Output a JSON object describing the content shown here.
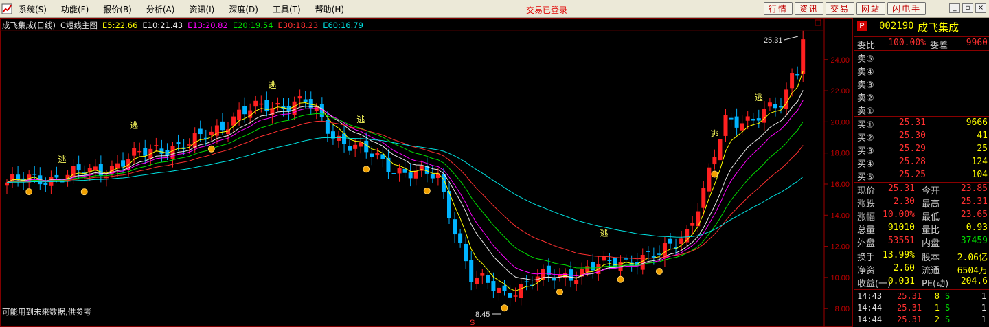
{
  "menubar": {
    "menus": [
      "系统(S)",
      "功能(F)",
      "报价(B)",
      "分析(A)",
      "资讯(I)",
      "深度(D)",
      "工具(T)",
      "帮助(H)"
    ],
    "login_status": "交易已登录",
    "tool_buttons": [
      "行情",
      "资讯",
      "交易",
      "网站",
      "闪电手"
    ],
    "window_buttons": [
      "minimize",
      "restore",
      "close"
    ]
  },
  "chart": {
    "title": "成飞集成(日线)",
    "indicator": "C短线主图",
    "ma": [
      {
        "label": "E5:22.66",
        "color": "#ffff00"
      },
      {
        "label": "E10:21.43",
        "color": "#e8e8e8"
      },
      {
        "label": "E13:20.82",
        "color": "#ff00ff"
      },
      {
        "label": "E20:19.54",
        "color": "#00dd00"
      },
      {
        "label": "E30:18.23",
        "color": "#ff3030"
      },
      {
        "label": "E60:16.79",
        "color": "#00e0e0"
      }
    ],
    "y_ticks": [
      "24.00",
      "22.00",
      "20.00",
      "18.00",
      "16.00",
      "14.00",
      "12.00",
      "10.00",
      "8.00"
    ],
    "high_label": "25.31",
    "low_label": "8.45",
    "marker_escape": "逃",
    "marker_s": "S",
    "footnote": "可能用到未来数据,供参考",
    "up_color": "#ff2020",
    "down_color": "#00b4ff"
  },
  "panel": {
    "code": "002190",
    "name": "成飞集成",
    "icon_letter": "P",
    "weibi_label": "委比",
    "weibi_value": "100.00%",
    "weicha_label": "委差",
    "weicha_value": "9960",
    "sells": [
      {
        "label": "卖⑤",
        "price": "",
        "vol": ""
      },
      {
        "label": "卖④",
        "price": "",
        "vol": ""
      },
      {
        "label": "卖③",
        "price": "",
        "vol": ""
      },
      {
        "label": "卖②",
        "price": "",
        "vol": ""
      },
      {
        "label": "卖①",
        "price": "",
        "vol": ""
      }
    ],
    "buys": [
      {
        "label": "买①",
        "price": "25.31",
        "vol": "9666"
      },
      {
        "label": "买②",
        "price": "25.30",
        "vol": "41"
      },
      {
        "label": "买③",
        "price": "25.29",
        "vol": "25"
      },
      {
        "label": "买④",
        "price": "25.28",
        "vol": "124"
      },
      {
        "label": "买⑤",
        "price": "25.25",
        "vol": "104"
      }
    ],
    "stats": [
      {
        "l1": "现价",
        "v1": "25.31",
        "c1": "#ff3030",
        "l2": "今开",
        "v2": "23.85",
        "c2": "#ff3030"
      },
      {
        "l1": "涨跌",
        "v1": "2.30",
        "c1": "#ff3030",
        "l2": "最高",
        "v2": "25.31",
        "c2": "#ff3030"
      },
      {
        "l1": "涨幅",
        "v1": "10.00%",
        "c1": "#ff3030",
        "l2": "最低",
        "v2": "23.65",
        "c2": "#ff3030"
      },
      {
        "l1": "总量",
        "v1": "91010",
        "c1": "#ffff00",
        "l2": "量比",
        "v2": "0.93",
        "c2": "#ffff00"
      },
      {
        "l1": "外盘",
        "v1": "53551",
        "c1": "#ff3030",
        "l2": "内盘",
        "v2": "37459",
        "c2": "#00dd00"
      }
    ],
    "stats2": [
      {
        "l1": "换手",
        "v1": "13.99%",
        "c1": "#ffff00",
        "l2": "股本",
        "v2": "2.06亿",
        "c2": "#ffff00"
      },
      {
        "l1": "净资",
        "v1": "2.60",
        "c1": "#ffff00",
        "l2": "流通",
        "v2": "6504万",
        "c2": "#ffff00"
      },
      {
        "l1": "收益(一)",
        "v1": "0.031",
        "c1": "#ffff00",
        "l2": "PE(动)",
        "v2": "204.6",
        "c2": "#ffff00"
      }
    ],
    "ticks": [
      {
        "time": "14:43",
        "price": "25.31",
        "vol": "8",
        "side": "S",
        "n": "1"
      },
      {
        "time": "14:44",
        "price": "25.31",
        "vol": "1",
        "side": "S",
        "n": "1"
      },
      {
        "time": "14:44",
        "price": "25.31",
        "vol": "2",
        "side": "S",
        "n": "1"
      }
    ]
  }
}
